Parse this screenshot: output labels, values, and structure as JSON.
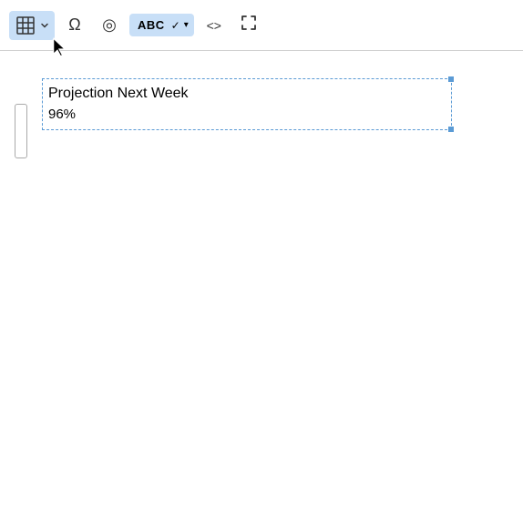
{
  "toolbar": {
    "table_icon": "table-icon",
    "table_dropdown_label": "▾",
    "omega_label": "Ω",
    "target_icon": "◎",
    "abc_label": "ABC",
    "checkmark": "✓",
    "dropdown_arrow": "▾",
    "code_icon": "<>",
    "expand_icon": "⤢"
  },
  "content": {
    "title": "Projection Next Week",
    "subtitle": "96%"
  }
}
